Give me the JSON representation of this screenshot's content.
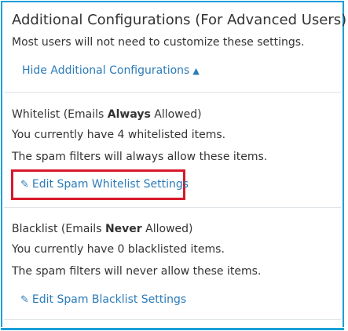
{
  "panel": {
    "title": "Additional Configurations (For Advanced Users):",
    "subtitle": "Most users will not need to customize these settings.",
    "toggle_label": "Hide Additional Configurations",
    "toggle_icon": "caret-up-icon"
  },
  "whitelist": {
    "heading_prefix": "Whitelist (Emails ",
    "heading_strong": "Always",
    "heading_suffix": " Allowed)",
    "count_text": "You currently have 4 whitelisted items.",
    "description": "The spam filters will always allow these items.",
    "edit_label": "Edit Spam Whitelist Settings",
    "edit_icon": "pencil-icon"
  },
  "blacklist": {
    "heading_prefix": "Blacklist (Emails ",
    "heading_strong": "Never",
    "heading_suffix": " Allowed)",
    "count_text": "You currently have 0 blacklisted items.",
    "description": "The spam filters will never allow these items.",
    "edit_label": "Edit Spam Blacklist Settings",
    "edit_icon": "pencil-icon"
  },
  "colors": {
    "border": "#1aa0d8",
    "link": "#2b7bb9",
    "highlight": "#d8182a"
  }
}
